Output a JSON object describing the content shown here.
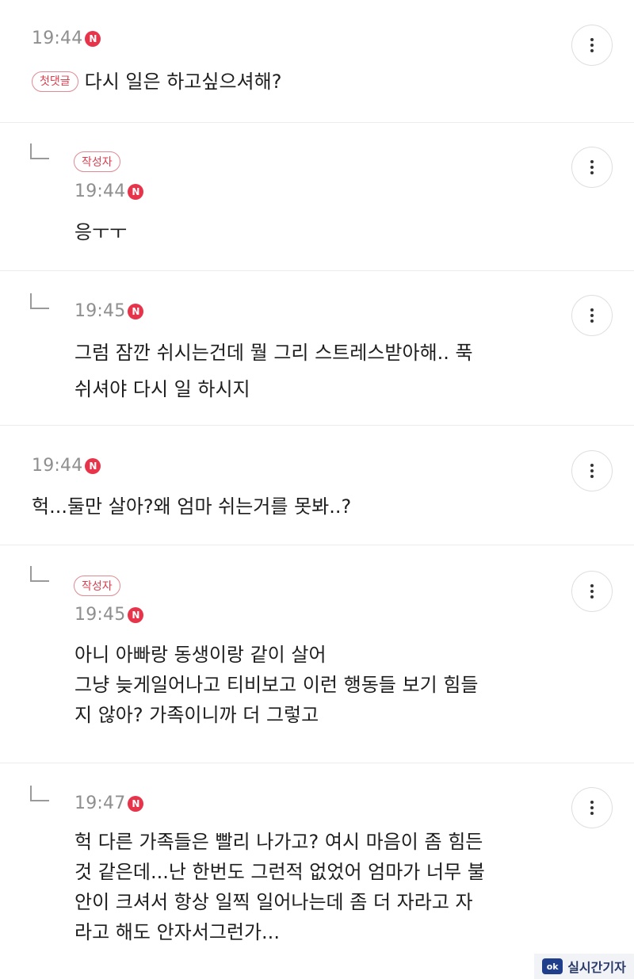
{
  "comments": [
    {
      "time": "19:44",
      "new_badge": "N",
      "tag": "첫댓글",
      "lines": [
        "다시 일은 하고싶으셔해?"
      ]
    },
    {
      "time": "19:44",
      "new_badge": "N",
      "tag": "작성자",
      "lines": [
        "응ㅜㅜ"
      ]
    },
    {
      "time": "19:45",
      "new_badge": "N",
      "lines": [
        "그럼 잠깐 쉬시는건데 뭘 그리 스트레스받아해.. 푹",
        "쉬셔야 다시 일 하시지"
      ]
    },
    {
      "time": "19:44",
      "new_badge": "N",
      "lines": [
        "헉...둘만 살아?왜 엄마 쉬는거를 못봐..?"
      ]
    },
    {
      "time": "19:45",
      "new_badge": "N",
      "tag": "작성자",
      "lines": [
        "아니 아빠랑 동생이랑 같이 살어",
        "그냥 늦게일어나고 티비보고 이런 행동들 보기 힘들",
        "지 않아? 가족이니까 더 그렇고"
      ]
    },
    {
      "time": "19:47",
      "new_badge": "N",
      "lines": [
        "헉 다른 가족들은 빨리 나가고? 여시 마음이 좀 힘든",
        "것 같은데...난 한번도 그런적 없었어 엄마가 너무 불",
        "안이 크셔서 항상 일찍 일어나는데 좀 더 자라고 자",
        "라고 해도 안자서그런가..."
      ]
    }
  ],
  "watermark": {
    "logo": "ok",
    "text": "실시간기자"
  },
  "colors": {
    "badge": "#e8344a",
    "tag_border": "#e08a93",
    "tag_text": "#d9404f",
    "time": "#8f8f8f",
    "divider": "#ececec"
  },
  "icons": {
    "more": "more-vertical-icon",
    "reply": "reply-arrow-icon"
  }
}
